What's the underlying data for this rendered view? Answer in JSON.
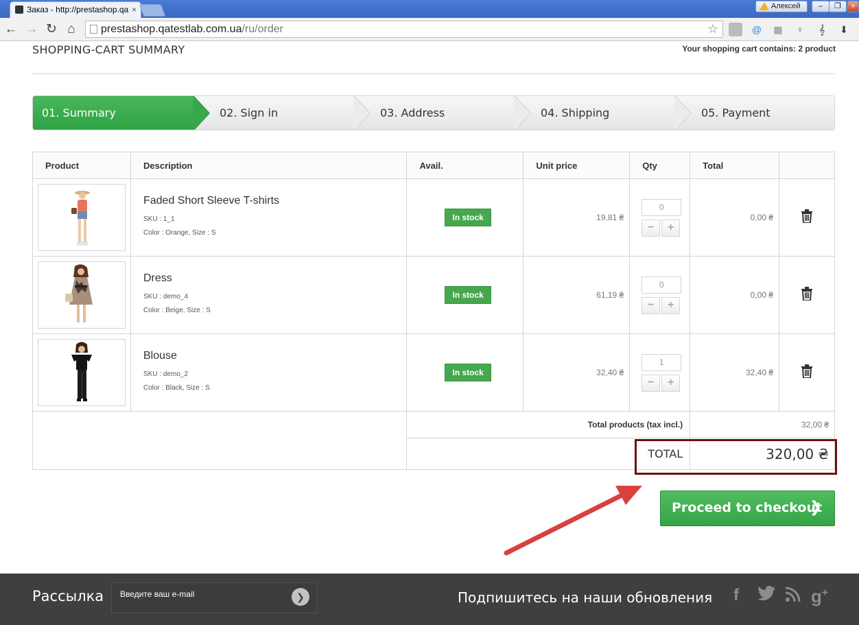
{
  "browser": {
    "tab_title": "Заказ - http://prestashop.qa",
    "user_name": "Алексей",
    "url_host": "prestashop.qatestlab.com.ua",
    "url_path": "/ru/order"
  },
  "page": {
    "heading": "Shopping-cart summary",
    "cart_count": "Your shopping cart contains: 2 product"
  },
  "steps": [
    {
      "label": "01. Summary",
      "active": true
    },
    {
      "label": "02. Sign in",
      "active": false
    },
    {
      "label": "03. Address",
      "active": false
    },
    {
      "label": "04. Shipping",
      "active": false
    },
    {
      "label": "05. Payment",
      "active": false
    }
  ],
  "table": {
    "headers": {
      "product": "Product",
      "description": "Description",
      "avail": "Avail.",
      "unit_price": "Unit price",
      "qty": "Qty",
      "total": "Total"
    },
    "rows": [
      {
        "name": "Faded Short Sleeve T-shirts",
        "sku": "SKU : 1_1",
        "attrs": "Color : Orange, Size : S",
        "avail": "In stock",
        "unit_price": "19,81 ₴",
        "qty": "0",
        "total": "0,00 ₴"
      },
      {
        "name": "Dress",
        "sku": "SKU : demo_4",
        "attrs": "Color : Beige, Size : S",
        "avail": "In stock",
        "unit_price": "61,19 ₴",
        "qty": "0",
        "total": "0,00 ₴"
      },
      {
        "name": "Blouse",
        "sku": "SKU : demo_2",
        "attrs": "Color : Black, Size : S",
        "avail": "In stock",
        "unit_price": "32,40 ₴",
        "qty": "1",
        "total": "32,40 ₴"
      }
    ],
    "qty_minus": "−",
    "qty_plus": "+",
    "total_products_label": "Total products (tax incl.)",
    "total_products_value": "32,00 ₴",
    "total_label": "TOTAL",
    "total_value": "320,00 ₴"
  },
  "checkout": {
    "label": "Proceed to checkout",
    "arrow": "❯"
  },
  "footer": {
    "newsletter_title": "Рассылка",
    "newsletter_placeholder": "Введите ваш e-mail",
    "newsletter_submit": "❯",
    "follow_title": "Подпишитесь на наши обновления",
    "social": [
      "f",
      "twitter",
      "rss",
      "g+"
    ]
  },
  "colors": {
    "accent_green": "#46a74e",
    "highlight_box": "#6b0f10",
    "annotation_arrow": "#d9413f",
    "footer_bg": "#3f3f3f"
  }
}
